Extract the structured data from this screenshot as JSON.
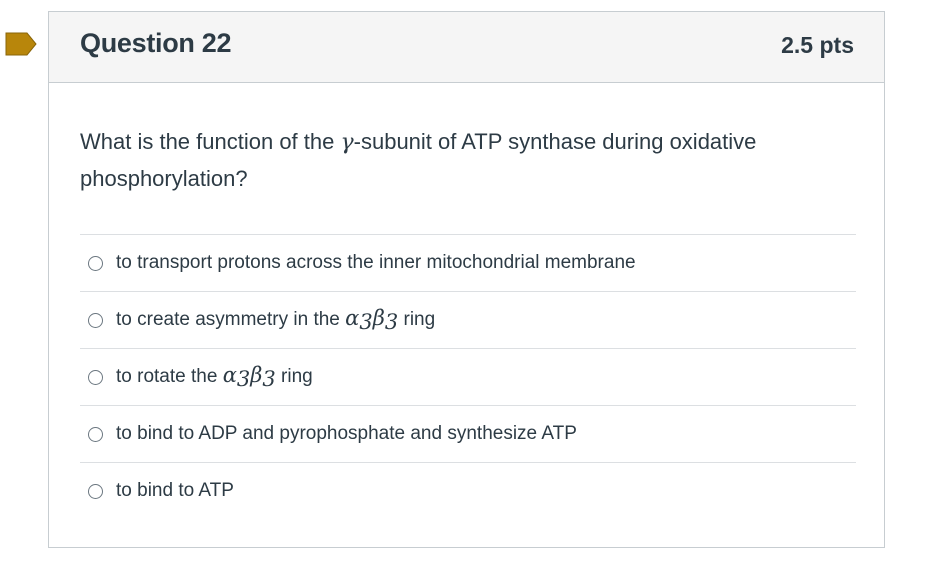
{
  "question": {
    "title": "Question 22",
    "points": "2.5 pts",
    "flag_color": "#b8860b",
    "text_before": "What is the function of the ",
    "text_symbol": "γ",
    "text_after": "-subunit of ATP synthase during oxidative phosphorylation?"
  },
  "answers": [
    {
      "text": "to transport protons across the inner mitochondrial membrane"
    },
    {
      "text_before": "to create asymmetry in the ",
      "symbol": "α",
      "sub1": "3",
      "symbol2": "β",
      "sub2": "3",
      "text_after": " ring"
    },
    {
      "text_before": "to rotate the ",
      "symbol": "α",
      "sub1": "3",
      "symbol2": "β",
      "sub2": "3",
      "text_after": " ring"
    },
    {
      "text": "to bind to ADP and pyrophosphate and synthesize ATP"
    },
    {
      "text": "to bind to ATP"
    }
  ]
}
